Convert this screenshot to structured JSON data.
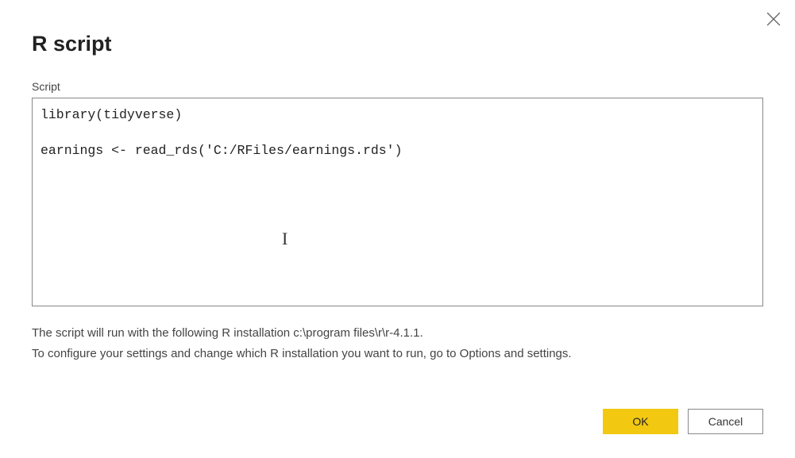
{
  "dialog": {
    "title": "R script",
    "close_icon": "close-icon"
  },
  "script": {
    "label": "Script",
    "content": "library(tidyverse)\n\nearnings <- read_rds('C:/RFiles/earnings.rds')"
  },
  "info": {
    "line1": "The script will run with the following R installation c:\\program files\\r\\r-4.1.1.",
    "line2": "To configure your settings and change which R installation you want to run, go to Options and settings."
  },
  "buttons": {
    "ok": "OK",
    "cancel": "Cancel"
  },
  "colors": {
    "primary": "#F2C811"
  }
}
